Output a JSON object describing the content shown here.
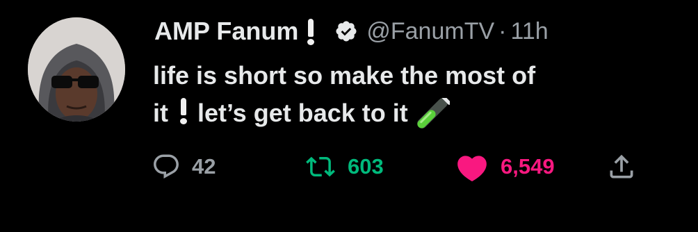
{
  "tweet": {
    "display_name": "AMP Fanum",
    "handle": "@FanumTV",
    "separator": "·",
    "time": "11h",
    "text_line1": "life is short so make the most of",
    "text_line2_a": "it",
    "text_line2_b": "let’s get back to it",
    "emoji": [
      "heavy-exclamation-mark",
      "test-tube"
    ]
  },
  "actions": {
    "reply_count": "42",
    "retweet_count": "603",
    "like_count": "6,549"
  },
  "colors": {
    "background": "#000000",
    "text": "#e7e9ea",
    "muted": "#9aa0a6",
    "retweet": "#00ba7c",
    "like": "#f91880"
  }
}
